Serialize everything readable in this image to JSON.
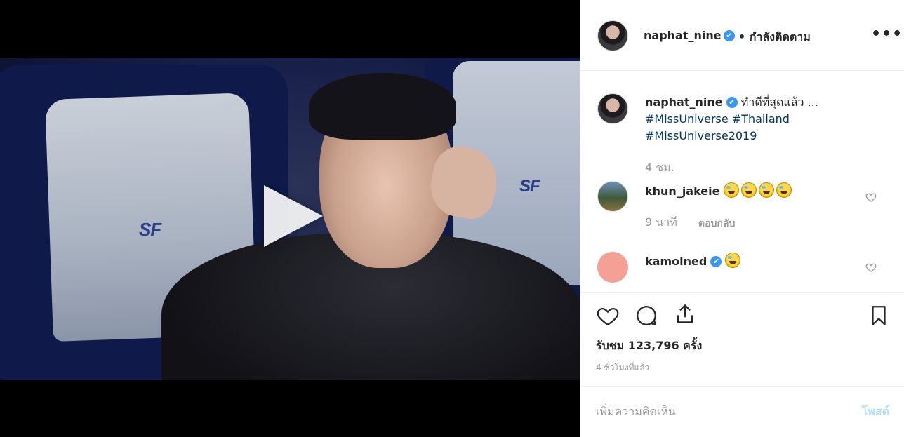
{
  "video": {
    "logo_left": "SF",
    "logo_right": "SF"
  },
  "header": {
    "username": "naphat_nine",
    "verified_mark": "✔",
    "follow_status": "• กำลังติดตาม",
    "more_label": "•••"
  },
  "caption": {
    "username": "naphat_nine",
    "verified_mark": "✔",
    "text": "ทำดีที่สุดแล้ว ...",
    "hashtags": [
      "#MissUniverse",
      "#Thailand",
      "#MissUniverse2019"
    ],
    "age": "4 ชม."
  },
  "comments": [
    {
      "username": "khun_jakeie",
      "verified": false,
      "emoji_count": 4,
      "age": "9 นาที",
      "reply_label": "ตอบกลับ"
    },
    {
      "username": "kamolned",
      "verified": true,
      "verified_mark": "✔",
      "emoji_count": 1
    }
  ],
  "stats": {
    "views": "รับชม 123,796 ครั้ง",
    "time_ago": "4 ชั่วโมงที่แล้ว"
  },
  "composer": {
    "placeholder": "เพิ่มความคิดเห็น",
    "post_label": "โพสต์"
  },
  "icons": {
    "play": "play-icon",
    "like": "heart-icon",
    "comment": "comment-icon",
    "share": "share-icon",
    "save": "bookmark-icon",
    "more": "more-options-icon"
  },
  "colors": {
    "verified": "#3897f0",
    "hashtag": "#003569",
    "post_disabled": "#b2dffc",
    "avatar_kamolned": "#f4a095"
  }
}
